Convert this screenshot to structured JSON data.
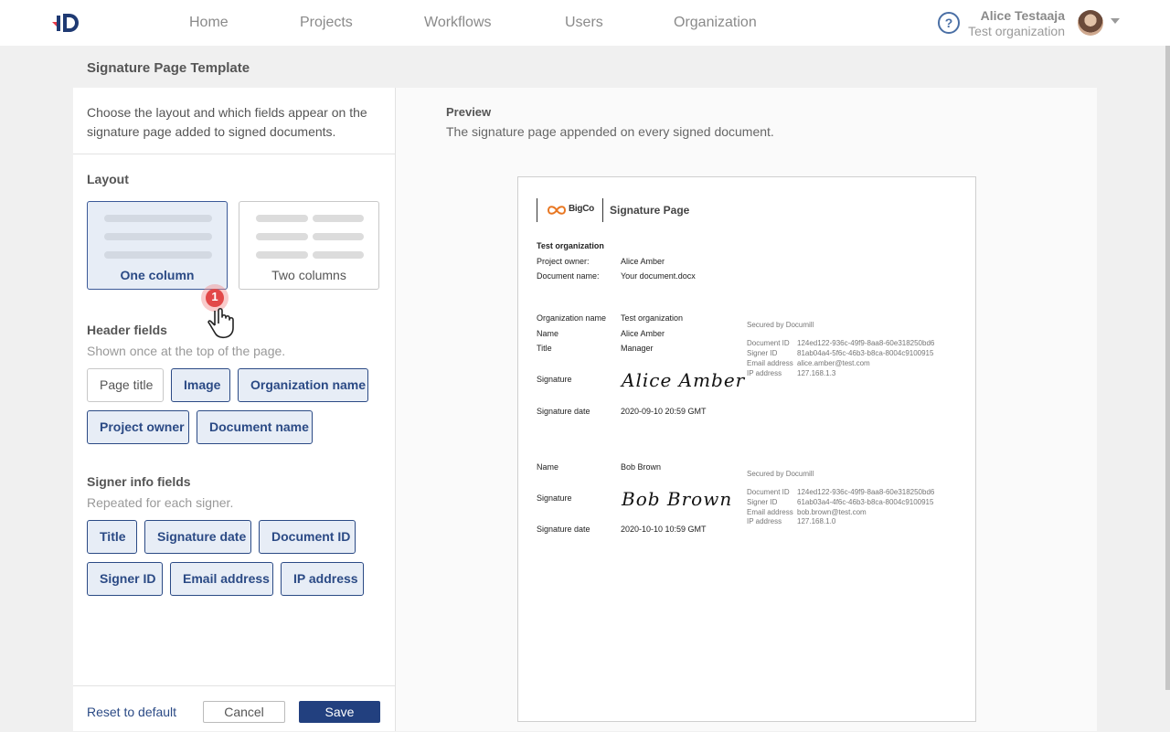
{
  "nav": {
    "items": [
      "Home",
      "Projects",
      "Workflows",
      "Users",
      "Organization"
    ],
    "help": "?",
    "user": {
      "name": "Alice Testaaja",
      "org": "Test organization"
    }
  },
  "page": {
    "title": "Signature Page Template"
  },
  "settings": {
    "intro": "Choose the layout and which fields appear on the signature page added to signed documents.",
    "layout": {
      "heading": "Layout",
      "options": [
        {
          "label": "One column",
          "selected": true
        },
        {
          "label": "Two columns",
          "selected": false
        }
      ]
    },
    "header_fields": {
      "heading": "Header fields",
      "hint": "Shown once at the top of the page.",
      "chips": [
        {
          "label": "Page title",
          "on": false
        },
        {
          "label": "Image",
          "on": true
        },
        {
          "label": "Organization name",
          "on": true
        },
        {
          "label": "Project owner",
          "on": true
        },
        {
          "label": "Document name",
          "on": true
        }
      ]
    },
    "signer_fields": {
      "heading": "Signer info fields",
      "hint": "Repeated for each signer.",
      "chips": [
        {
          "label": "Title",
          "on": true
        },
        {
          "label": "Signature date",
          "on": true
        },
        {
          "label": "Document ID",
          "on": true
        },
        {
          "label": "Signer ID",
          "on": true
        },
        {
          "label": "Email address",
          "on": true
        },
        {
          "label": "IP address",
          "on": true
        }
      ]
    },
    "footer": {
      "reset": "Reset to default",
      "cancel": "Cancel",
      "save": "Save"
    },
    "step_marker": "1"
  },
  "preview": {
    "heading": "Preview",
    "subtitle": "The signature page appended on every signed document.",
    "doc": {
      "logo_text": "BigCo",
      "title": "Signature Page",
      "org_heading": "Test organization",
      "project_owner_label": "Project owner:",
      "project_owner_value": "Alice Amber",
      "doc_name_label": "Document name:",
      "doc_name_value": "Your document.docx",
      "signer1": {
        "org_label": "Organization name",
        "org_value": "Test organization",
        "name_label": "Name",
        "name_value": "Alice Amber",
        "title_label": "Title",
        "title_value": "Manager",
        "sig_label": "Signature",
        "sig_value": "Alice Amber",
        "date_label": "Signature date",
        "date_value": "2020-09-10 20:59 GMT",
        "secured": "Secured by Documill",
        "docid_label": "Document ID",
        "docid_value": "124ed122-936c-49f9-8aa8-60e318250bd6",
        "signerid_label": "Signer ID",
        "signerid_value": "81ab04a4-5f6c-46b3-b8ca-8004c9100915",
        "email_label": "Email address",
        "email_value": "alice.amber@test.com",
        "ip_label": "IP address",
        "ip_value": "127.168.1.3"
      },
      "signer2": {
        "name_label": "Name",
        "name_value": "Bob Brown",
        "sig_label": "Signature",
        "sig_value": "Bob Brown",
        "date_label": "Signature date",
        "date_value": "2020-10-10 10:59 GMT",
        "secured": "Secured by Documill",
        "docid_label": "Document ID",
        "docid_value": "124ed122-936c-49f9-8aa8-60e318250bd6",
        "signerid_label": "Signer ID",
        "signerid_value": "61ab03a4-4f6c-46b3-b8ca-8004c9100915",
        "email_label": "Email address",
        "email_value": "bob.brown@test.com",
        "ip_label": "IP address",
        "ip_value": "127.168.1.0"
      }
    }
  },
  "colors": {
    "accent": "#2b4a85",
    "logo_red": "#e63946",
    "logo_navy": "#1f3a73",
    "bigco_orange": "#e87722"
  }
}
